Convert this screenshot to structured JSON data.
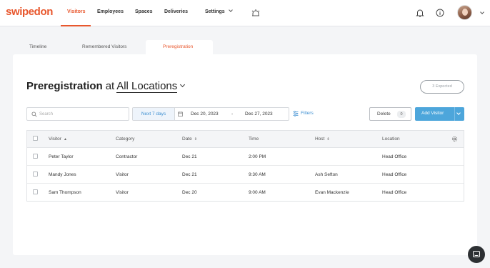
{
  "brand": {
    "logo": "swipedon",
    "accent": "#e8572d",
    "primary": "#4da6db"
  },
  "nav": {
    "items": [
      {
        "label": "Visitors",
        "active": true
      },
      {
        "label": "Employees"
      },
      {
        "label": "Spaces"
      },
      {
        "label": "Deliveries"
      },
      {
        "label": "Settings"
      }
    ],
    "icons": [
      "reception-icon",
      "bell-icon",
      "info-icon",
      "avatar",
      "chevron-down-icon"
    ]
  },
  "subtabs": [
    {
      "label": "Timeline"
    },
    {
      "label": "Remembered Visitors"
    },
    {
      "label": "Preregistration",
      "active": true
    }
  ],
  "page": {
    "title": "Preregistration",
    "at": "at",
    "location": "All Locations",
    "expected_count": "3",
    "expected_label": "Expected"
  },
  "toolbar": {
    "search_placeholder": "Search",
    "quick_range": "Next 7 days",
    "date_from": "Dec 20, 2023",
    "date_sep": "-",
    "date_to": "Dec 27, 2023",
    "filters": "Filters",
    "delete_label": "Delete",
    "delete_count": "0",
    "add_label": "Add Visitor"
  },
  "table": {
    "headers": [
      "Visitor",
      "Category",
      "Date",
      "Time",
      "Host",
      "Location"
    ],
    "rows": [
      [
        "Peter Taylor",
        "Contractor",
        "Dec 21",
        "2:00 PM",
        "",
        "Head Office"
      ],
      [
        "Mandy Jones",
        "Visitor",
        "Dec 21",
        "9:30 AM",
        "Ash Sefton",
        "Head Office"
      ],
      [
        "Sam Thompson",
        "Visitor",
        "Dec 20",
        "9:00 AM",
        "Evan Mackenzie",
        "Head Office"
      ]
    ]
  }
}
